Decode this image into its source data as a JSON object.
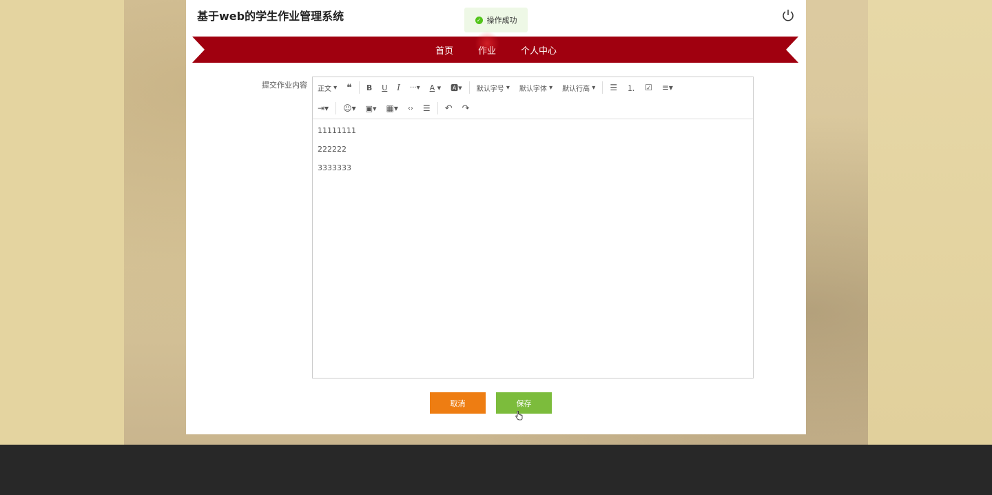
{
  "app": {
    "title": "基于web的学生作业管理系统"
  },
  "toast": {
    "text": "操作成功"
  },
  "nav": {
    "items": [
      "首页",
      "作业",
      "个人中心"
    ],
    "active_index": 1
  },
  "form": {
    "label": "提交作业内容"
  },
  "editor": {
    "toolbar": {
      "paragraph": "正文",
      "font_size": "默认字号",
      "font_family": "默认字体",
      "line_height": "默认行高"
    },
    "lines": [
      "11111111",
      "222222",
      "3333333"
    ]
  },
  "buttons": {
    "cancel": "取消",
    "save": "保存"
  },
  "colors": {
    "ribbon": "#a0000f",
    "cancel": "#ee7d12",
    "save": "#7cbc3c",
    "toast_icon": "#52c41a"
  }
}
